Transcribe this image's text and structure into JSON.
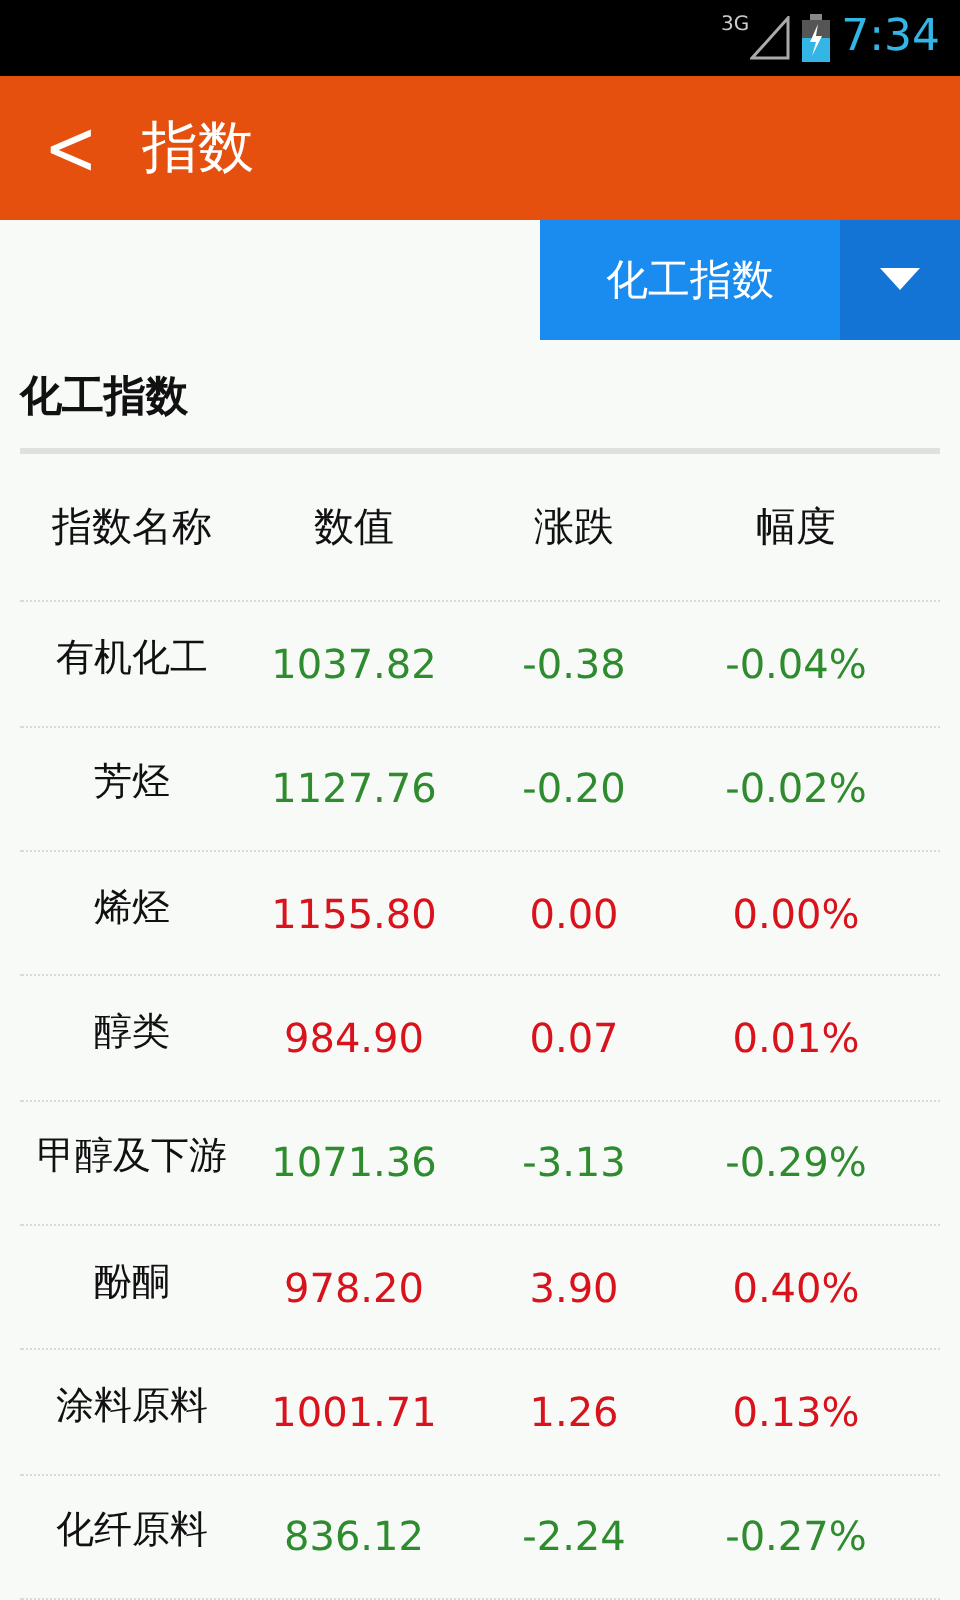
{
  "status_bar": {
    "network": "3G",
    "time": "7:34"
  },
  "header": {
    "back": "<",
    "title": "指数"
  },
  "dropdown": {
    "label": "化工指数"
  },
  "section_title": "化工指数",
  "table": {
    "columns": [
      "指数名称",
      "数值",
      "涨跌",
      "幅度"
    ],
    "rows": [
      {
        "name": "有机化工",
        "value": "1037.82",
        "change": "-0.38",
        "percent": "-0.04%",
        "color": "#2e8b2e"
      },
      {
        "name": "芳烃",
        "value": "1127.76",
        "change": "-0.20",
        "percent": "-0.02%",
        "color": "#2e8b2e"
      },
      {
        "name": "烯烃",
        "value": "1155.80",
        "change": "0.00",
        "percent": "0.00%",
        "color": "#d8131c"
      },
      {
        "name": "醇类",
        "value": "984.90",
        "change": "0.07",
        "percent": "0.01%",
        "color": "#d8131c"
      },
      {
        "name": "甲醇及下游",
        "value": "1071.36",
        "change": "-3.13",
        "percent": "-0.29%",
        "color": "#2e8b2e"
      },
      {
        "name": "酚酮",
        "value": "978.20",
        "change": "3.90",
        "percent": "0.40%",
        "color": "#d8131c"
      },
      {
        "name": "涂料原料",
        "value": "1001.71",
        "change": "1.26",
        "percent": "0.13%",
        "color": "#d8131c"
      },
      {
        "name": "化纤原料",
        "value": "836.12",
        "change": "-2.24",
        "percent": "-0.27%",
        "color": "#2e8b2e"
      }
    ]
  }
}
